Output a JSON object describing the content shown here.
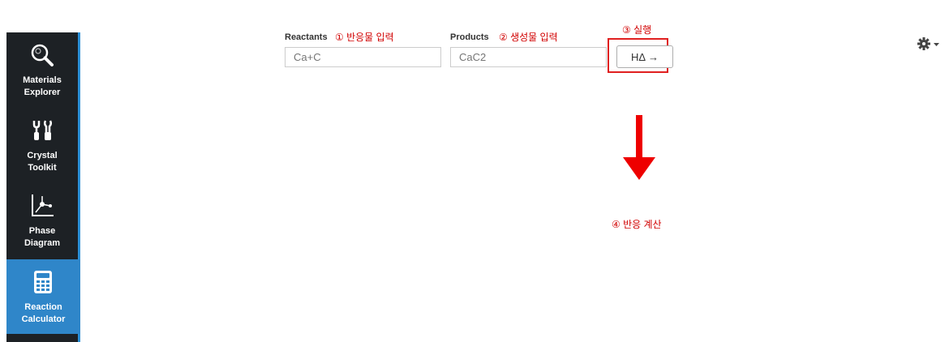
{
  "sidebar": {
    "items": [
      {
        "label": "Materials\nExplorer",
        "icon": "magnifier-icon"
      },
      {
        "label": "Crystal\nToolkit",
        "icon": "tools-icon"
      },
      {
        "label": "Phase\nDiagram",
        "icon": "phase-diagram-icon"
      },
      {
        "label": "Reaction\nCalculator",
        "icon": "calculator-icon",
        "active": true
      }
    ]
  },
  "form": {
    "reactants_label": "Reactants",
    "reactants_annotation": "① 반응물 입력",
    "reactants_placeholder": "Ca+C",
    "products_label": "Products",
    "products_annotation": "② 생성물 입력",
    "products_placeholder": "CaC2",
    "run_annotation": "③ 실행",
    "run_button_label": "HΔ →",
    "result_annotation": "④ 반응 계산"
  },
  "colors": {
    "sidebar_bg": "#1d2125",
    "active_item_bg": "#2f86c9",
    "annotation_red": "#d10000"
  },
  "header": {
    "settings_icon": "gear-icon"
  }
}
